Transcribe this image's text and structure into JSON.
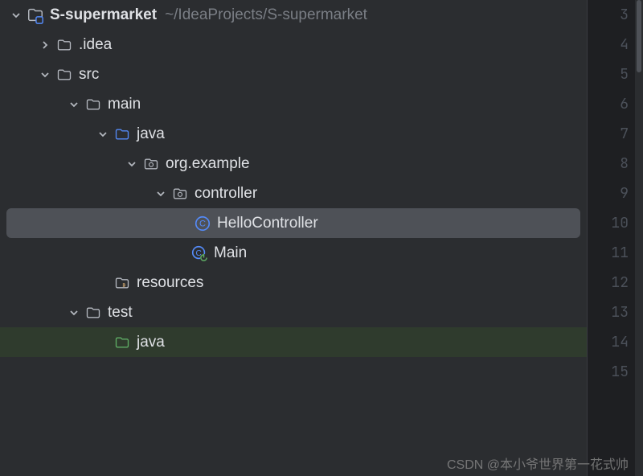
{
  "tree": {
    "root": {
      "name": "S-supermarket",
      "path": "~/IdeaProjects/S-supermarket"
    },
    "items": [
      {
        "label": ".idea",
        "indent": 1,
        "arrow": "right",
        "icon": "folder-gray"
      },
      {
        "label": "src",
        "indent": 1,
        "arrow": "down",
        "icon": "folder-gray"
      },
      {
        "label": "main",
        "indent": 2,
        "arrow": "down",
        "icon": "folder-gray"
      },
      {
        "label": "java",
        "indent": 3,
        "arrow": "down",
        "icon": "folder-blue"
      },
      {
        "label": "org.example",
        "indent": 4,
        "arrow": "down",
        "icon": "package"
      },
      {
        "label": "controller",
        "indent": 5,
        "arrow": "down",
        "icon": "package"
      },
      {
        "label": "HelloController",
        "indent": 6,
        "arrow": "",
        "icon": "class",
        "selected": true
      },
      {
        "label": "Main",
        "indent": 5,
        "arrow": "",
        "icon": "class-main"
      },
      {
        "label": "resources",
        "indent": 3,
        "arrow": "",
        "icon": "resources"
      },
      {
        "label": "test",
        "indent": 2,
        "arrow": "down",
        "icon": "folder-gray"
      },
      {
        "label": "java",
        "indent": 3,
        "arrow": "",
        "icon": "folder-green",
        "green": true
      }
    ]
  },
  "gutter": {
    "start": 3,
    "end": 15
  },
  "watermark": "CSDN @本小爷世界第一花式帅",
  "colors": {
    "bg": "#2b2d30",
    "selected": "#4e5157",
    "folder_gray": "#b4b8bf",
    "folder_blue": "#548af7",
    "folder_green": "#5fad65",
    "class_blue": "#548af7",
    "resources": "#c9a26d"
  }
}
